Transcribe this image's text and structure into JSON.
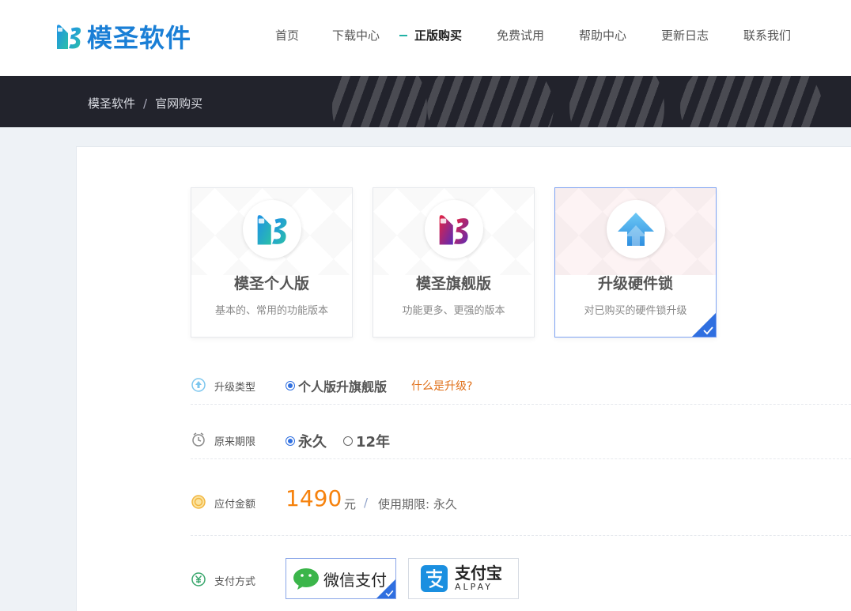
{
  "header": {
    "logo_text": "模圣软件",
    "nav": [
      {
        "label": "首页",
        "active": false
      },
      {
        "label": "下载中心",
        "active": false
      },
      {
        "label": "正版购买",
        "active": true
      },
      {
        "label": "免费试用",
        "active": false
      },
      {
        "label": "帮助中心",
        "active": false
      },
      {
        "label": "更新日志",
        "active": false
      },
      {
        "label": "联系我们",
        "active": false
      }
    ]
  },
  "breadcrumb": {
    "home": "模圣软件",
    "separator": "/",
    "current": "官网购买"
  },
  "products": [
    {
      "title": "模圣个人版",
      "desc": "基本的、常用的功能版本",
      "icon": "ms-logo-blue-icon",
      "selected": false
    },
    {
      "title": "模圣旗舰版",
      "desc": "功能更多、更强的版本",
      "icon": "ms-logo-red-icon",
      "selected": false
    },
    {
      "title": "升级硬件锁",
      "desc": "对已购买的硬件锁升级",
      "icon": "upgrade-arrow-icon",
      "selected": true
    }
  ],
  "form": {
    "upgrade_type": {
      "label": "升级类型",
      "option": "个人版升旗舰版",
      "help_link": "什么是升级?"
    },
    "original_term": {
      "label": "原来期限",
      "options": [
        {
          "label": "永久",
          "checked": true
        },
        {
          "label": "12年",
          "checked": false
        }
      ]
    },
    "amount": {
      "label": "应付金额",
      "value": "1490",
      "unit": "元",
      "separator": "/",
      "term_note": "使用期限: 永久"
    },
    "payment": {
      "label": "支付方式",
      "wechat": "微信支付",
      "alipay_cn": "支付宝",
      "alipay_en": "ALPAY",
      "selected": "wechat"
    }
  },
  "colors": {
    "brand": "#1a7fd6",
    "accent": "#22b2a6",
    "price": "#f6820d",
    "link": "#e0701a",
    "select": "#2f6fe0"
  }
}
